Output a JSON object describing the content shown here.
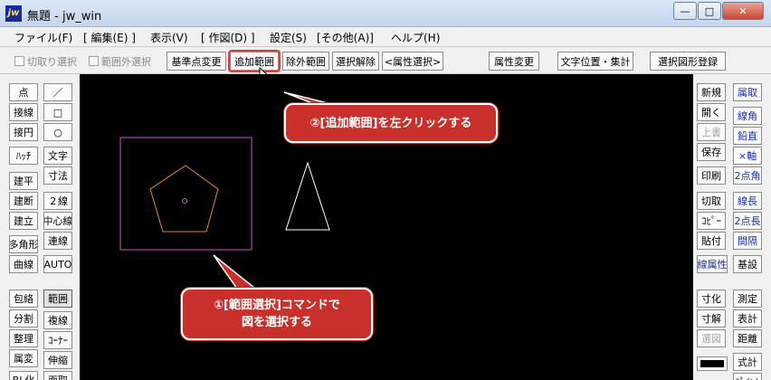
{
  "window": {
    "app_icon": "jw",
    "title": "無題 - jw_win",
    "minimize_label": "—",
    "maximize_label": "□",
    "close_label": "✕"
  },
  "menu": [
    "ファイル(F)",
    "[ 編集(E) ]",
    "表示(V)",
    "[ 作図(D) ]",
    "設定(S)",
    "[その他(A)]",
    "ヘルプ(H)"
  ],
  "toolbar": {
    "checkbox_cut": "切取り選択",
    "checkbox_outside": "範囲外選択",
    "btn_basepoint": "基準点変更",
    "btn_add_range": "追加範囲",
    "btn_exclude_range": "除外範囲",
    "btn_deselect": "選択解除",
    "btn_attr_select": "<属性選択>",
    "btn_attr_change": "属性変更",
    "btn_text_pos": "文字位置・集計",
    "btn_register": "選択図形登録"
  },
  "left_col1": [
    "点",
    "接線",
    "接円",
    "ﾊｯﾁ",
    "建平",
    "建断",
    "建立",
    "多角形",
    "曲線",
    "包絡",
    "分割",
    "整理",
    "属変",
    "BL化"
  ],
  "left_col2": [
    "／",
    "□",
    "○",
    "文字",
    "寸法",
    "２線",
    "中心線",
    "連線",
    "AUTO",
    "範囲",
    "複線",
    "ｺｰﾅｰ",
    "伸縮",
    "面取"
  ],
  "right_col1": [
    "新規",
    "開く",
    "上書",
    "保存",
    "印刷",
    "切取",
    "ｺﾋﾟｰ",
    "貼付",
    "線属性",
    "寸化",
    "寸解",
    "選図"
  ],
  "right_col2": [
    "属取",
    "線角",
    "鉛直",
    "×軸",
    "2点角",
    "線長",
    "2点長",
    "間隔",
    "基設",
    "測定",
    "表計",
    "距離",
    "式計",
    "ﾎﾟｲﾝﾄ"
  ],
  "callouts": {
    "step2": "②[追加範囲]を左クリックする",
    "step1_line1": "①[範囲選択]コマンドで",
    "step1_line2": "図を選択する"
  }
}
